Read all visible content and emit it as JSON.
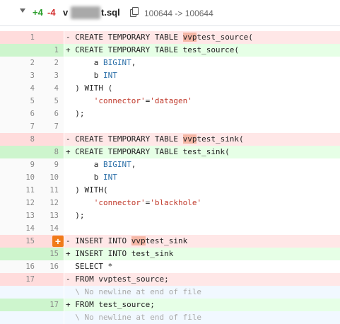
{
  "header": {
    "additions": "+4",
    "deletions": "-4",
    "filename_prefix": "v",
    "filename_suffix": "t.sql",
    "mode_change": "100644 -> 100644"
  },
  "icons": {
    "collapse": "chevron-down-icon",
    "copy": "copy-icon",
    "add_comment": "plus-icon"
  },
  "colors": {
    "deleted_line_bg": "#ffe7e7",
    "added_line_bg": "#e6ffe6",
    "highlight": "#f5b7a6",
    "comment_button": "#f07a1a"
  },
  "lines": [
    {
      "t": "del",
      "a": "1",
      "b": "",
      "p": "- ",
      "s": [
        {
          "c": "kw",
          "x": "CREATE TEMPORARY TABLE "
        },
        {
          "c": "hl",
          "x": "vvp"
        },
        {
          "c": "",
          "x": "test_source("
        }
      ]
    },
    {
      "t": "add",
      "a": "",
      "b": "1",
      "p": "+ ",
      "s": [
        {
          "c": "kw",
          "x": "CREATE TEMPORARY TABLE "
        },
        {
          "c": "",
          "x": "test_source("
        }
      ]
    },
    {
      "t": "ctx",
      "a": "2",
      "b": "2",
      "p": "  ",
      "s": [
        {
          "c": "",
          "x": "    a "
        },
        {
          "c": "ty",
          "x": "BIGINT"
        },
        {
          "c": "",
          "x": ","
        }
      ]
    },
    {
      "t": "ctx",
      "a": "3",
      "b": "3",
      "p": "  ",
      "s": [
        {
          "c": "",
          "x": "    b "
        },
        {
          "c": "ty",
          "x": "INT"
        }
      ]
    },
    {
      "t": "ctx",
      "a": "4",
      "b": "4",
      "p": "  ",
      "s": [
        {
          "c": "",
          "x": ") WITH ("
        }
      ]
    },
    {
      "t": "ctx",
      "a": "5",
      "b": "5",
      "p": "  ",
      "s": [
        {
          "c": "",
          "x": "    "
        },
        {
          "c": "st",
          "x": "'connector'"
        },
        {
          "c": "",
          "x": "="
        },
        {
          "c": "st",
          "x": "'datagen'"
        }
      ]
    },
    {
      "t": "ctx",
      "a": "6",
      "b": "6",
      "p": "  ",
      "s": [
        {
          "c": "",
          "x": ");"
        }
      ]
    },
    {
      "t": "ctx",
      "a": "7",
      "b": "7",
      "p": "  ",
      "s": [
        {
          "c": "",
          "x": ""
        }
      ]
    },
    {
      "t": "del",
      "a": "8",
      "b": "",
      "p": "- ",
      "s": [
        {
          "c": "kw",
          "x": "CREATE TEMPORARY TABLE "
        },
        {
          "c": "hl",
          "x": "vvp"
        },
        {
          "c": "",
          "x": "test_sink("
        }
      ]
    },
    {
      "t": "add",
      "a": "",
      "b": "8",
      "p": "+ ",
      "s": [
        {
          "c": "kw",
          "x": "CREATE TEMPORARY TABLE "
        },
        {
          "c": "",
          "x": "test_sink("
        }
      ]
    },
    {
      "t": "ctx",
      "a": "9",
      "b": "9",
      "p": "  ",
      "s": [
        {
          "c": "",
          "x": "    a "
        },
        {
          "c": "ty",
          "x": "BIGINT"
        },
        {
          "c": "",
          "x": ","
        }
      ]
    },
    {
      "t": "ctx",
      "a": "10",
      "b": "10",
      "p": "  ",
      "s": [
        {
          "c": "",
          "x": "    b "
        },
        {
          "c": "ty",
          "x": "INT"
        }
      ]
    },
    {
      "t": "ctx",
      "a": "11",
      "b": "11",
      "p": "  ",
      "s": [
        {
          "c": "",
          "x": ") WITH("
        }
      ]
    },
    {
      "t": "ctx",
      "a": "12",
      "b": "12",
      "p": "  ",
      "s": [
        {
          "c": "",
          "x": "    "
        },
        {
          "c": "st",
          "x": "'connector'"
        },
        {
          "c": "",
          "x": "="
        },
        {
          "c": "st",
          "x": "'blackhole'"
        }
      ]
    },
    {
      "t": "ctx",
      "a": "13",
      "b": "13",
      "p": "  ",
      "s": [
        {
          "c": "",
          "x": ");"
        }
      ]
    },
    {
      "t": "ctx",
      "a": "14",
      "b": "14",
      "p": "  ",
      "s": [
        {
          "c": "",
          "x": ""
        }
      ]
    },
    {
      "t": "del",
      "a": "15",
      "b": "",
      "p": "- ",
      "btn": true,
      "s": [
        {
          "c": "kw",
          "x": "INSERT INTO "
        },
        {
          "c": "hl",
          "x": "vvp"
        },
        {
          "c": "",
          "x": "test_sink"
        }
      ]
    },
    {
      "t": "add",
      "a": "",
      "b": "15",
      "p": "+ ",
      "s": [
        {
          "c": "kw",
          "x": "INSERT INTO "
        },
        {
          "c": "",
          "x": "test_sink"
        }
      ]
    },
    {
      "t": "ctx",
      "a": "16",
      "b": "16",
      "p": "  ",
      "s": [
        {
          "c": "kw",
          "x": "SELECT "
        },
        {
          "c": "",
          "x": "*"
        }
      ]
    },
    {
      "t": "del",
      "a": "17",
      "b": "",
      "p": "- ",
      "s": [
        {
          "c": "kw",
          "x": "FROM "
        },
        {
          "c": "",
          "x": "vvptest_source;"
        }
      ]
    },
    {
      "t": "note",
      "a": "",
      "b": "",
      "p": "  ",
      "s": [
        {
          "c": "",
          "x": "\\ No newline at end of file"
        }
      ]
    },
    {
      "t": "add",
      "a": "",
      "b": "17",
      "p": "+ ",
      "s": [
        {
          "c": "kw",
          "x": "FROM "
        },
        {
          "c": "",
          "x": "test_source;"
        }
      ]
    },
    {
      "t": "note",
      "a": "",
      "b": "",
      "p": "  ",
      "s": [
        {
          "c": "",
          "x": "\\ No newline at end of file"
        }
      ]
    }
  ]
}
